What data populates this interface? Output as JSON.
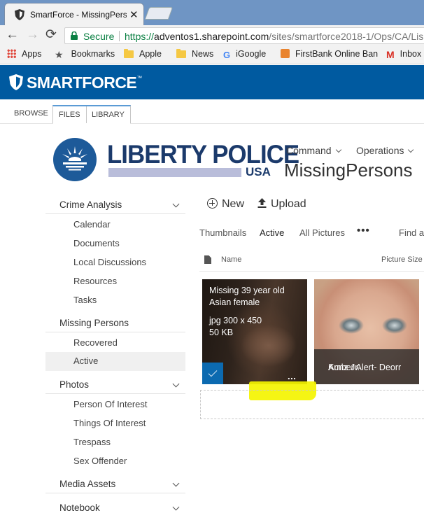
{
  "browser": {
    "tab_title": "SmartForce - MissingPers",
    "tab_close": "✕",
    "secure_label": "Secure",
    "url_proto": "https://",
    "url_host": "adventos1.sharepoint.com",
    "url_path": "/sites/smartforce2018-1/Ops/CA/Lis",
    "bookmarks": [
      "Apps",
      "Bookmarks",
      "Apple",
      "News",
      "iGoogle",
      "FirstBank Online Ban",
      "Inbox"
    ],
    "nav": {
      "back": "←",
      "forward": "→",
      "reload": "⟳"
    }
  },
  "suite": {
    "brand": "SMARTFORCE",
    "tm": "™"
  },
  "ribbon": {
    "tabs": [
      "Browse",
      "Files",
      "Library"
    ]
  },
  "site": {
    "logo_word": "LIBERTY POLICE",
    "logo_sub": "USA",
    "title": "MissingPersons",
    "topnav": [
      "Command",
      "Operations"
    ]
  },
  "quick_launch": {
    "crime_analysis": {
      "label": "Crime Analysis",
      "items": [
        "Calendar",
        "Documents",
        "Local Discussions",
        "Resources",
        "Tasks"
      ]
    },
    "missing_persons": {
      "label": "Missing Persons",
      "items": [
        "Recovered",
        "Active"
      ]
    },
    "photos": {
      "label": "Photos",
      "items": [
        "Person Of Interest",
        "Things Of Interest",
        "Trespass",
        "Sex Offender"
      ]
    },
    "media_assets": {
      "label": "Media Assets"
    },
    "notebook": {
      "label": "Notebook"
    }
  },
  "commands": {
    "new": "New",
    "upload": "Upload"
  },
  "views": {
    "thumbnails": "Thumbnails",
    "active": "Active",
    "all_pictures": "All Pictures",
    "more": "•••",
    "find": "Find a"
  },
  "columns": {
    "name": "Name",
    "picture_size": "Picture Size"
  },
  "tiles": [
    {
      "line1": "Missing 39 year old",
      "line2": "Asian female",
      "line3": "jpg 300 x 450",
      "line4": "50 KB",
      "dots": "..."
    },
    {
      "caption1": "Amber Alert- Deorr",
      "caption2": "Kunz Jr."
    }
  ]
}
